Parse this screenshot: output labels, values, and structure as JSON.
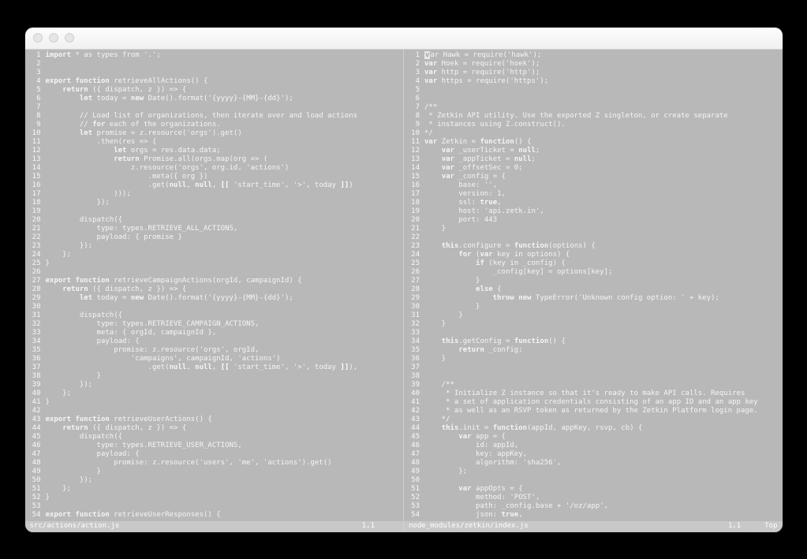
{
  "left": {
    "path": "src/actions/action.js",
    "pos": "1,1",
    "mode": "",
    "lines": [
      "import * as types from '.';",
      "",
      "",
      "export function retrieveAllActions() {",
      "    return ({ dispatch, z }) => {",
      "        let today = new Date().format('{yyyy}-{MM}-{dd}');",
      "",
      "        // Load list of organizations, then iterate over and load actions",
      "        // for each of the organizations.",
      "        let promise = z.resource('orgs').get()",
      "            .then(res => {",
      "                let orgs = res.data.data;",
      "                return Promise.all(orgs.map(org => (",
      "                    z.resource('orgs', org.id, 'actions')",
      "                        .meta({ org })",
      "                        .get(null, null, [[ 'start_time', '>', today ]])",
      "                )));",
      "            });",
      "",
      "        dispatch({",
      "            type: types.RETRIEVE_ALL_ACTIONS,",
      "            payload: { promise }",
      "        });",
      "    };",
      "}",
      "",
      "export function retrieveCampaignActions(orgId, campaignId) {",
      "    return ({ dispatch, z }) => {",
      "        let today = new Date().format('{yyyy}-{MM}-{dd}');",
      "",
      "        dispatch({",
      "            type: types.RETRIEVE_CAMPAIGN_ACTIONS,",
      "            meta: { orgId, campaignId },",
      "            payload: {",
      "                promise: z.resource('orgs', orgId,",
      "                    'campaigns', campaignId, 'actions')",
      "                        .get(null, null, [[ 'start_time', '>', today ]]),",
      "            }",
      "        });",
      "    };",
      "}",
      "",
      "export function retrieveUserActions() {",
      "    return ({ dispatch, z }) => {",
      "        dispatch({",
      "            type: types.RETRIEVE_USER_ACTIONS,",
      "            payload: {",
      "                promise: z.resource('users', 'me', 'actions').get()",
      "            }",
      "        });",
      "    };",
      "}",
      "",
      "export function retrieveUserResponses() {"
    ]
  },
  "right": {
    "path": "node_modules/zetkin/index.js",
    "pos": "1,1",
    "mode": "Top",
    "lines": [
      "var Hawk = require('hawk');",
      "var Hoek = require('hoek');",
      "var http = require('http');",
      "var https = require('https');",
      "",
      "",
      "/**",
      " * Zetkin API utility. Use the exported Z singleton, or create separate",
      " * instances using Z.construct().",
      "*/",
      "var Zetkin = function() {",
      "    var _userTicket = null;",
      "    var _appTicket = null;",
      "    var _offsetSec = 0;",
      "    var _config = {",
      "        base: '',",
      "        version: 1,",
      "        ssl: true,",
      "        host: 'api.zetk.in',",
      "        port: 443",
      "    }",
      "",
      "    this.configure = function(options) {",
      "        for (var key in options) {",
      "            if (key in _config) {",
      "                _config[key] = options[key];",
      "            }",
      "            else {",
      "                throw new TypeError('Unknown config option: ' + key);",
      "            }",
      "        }",
      "    }",
      "",
      "    this.getConfig = function() {",
      "        return _config;",
      "    }",
      "",
      "",
      "    /**",
      "     * Initialize Z instance so that it's ready to make API calls. Requires",
      "     * a set of application credentials consisting of an app ID and an app key",
      "     * as well as an RSVP token as returned by the Zetkin Platform login page.",
      "    */",
      "    this.init = function(appId, appKey, rsvp, cb) {",
      "        var app = {",
      "            id: appId,",
      "            key: appKey,",
      "            algorithm: 'sha256',",
      "        };",
      "",
      "        var appOpts = {",
      "            method: 'POST',",
      "            path: _config.base + '/oz/app',",
      "            json: true,"
    ]
  },
  "keywords": [
    "import",
    "export",
    "function",
    "return",
    "let",
    "var",
    "this",
    "new",
    "for",
    "if",
    "else",
    "throw",
    "null",
    "true"
  ]
}
